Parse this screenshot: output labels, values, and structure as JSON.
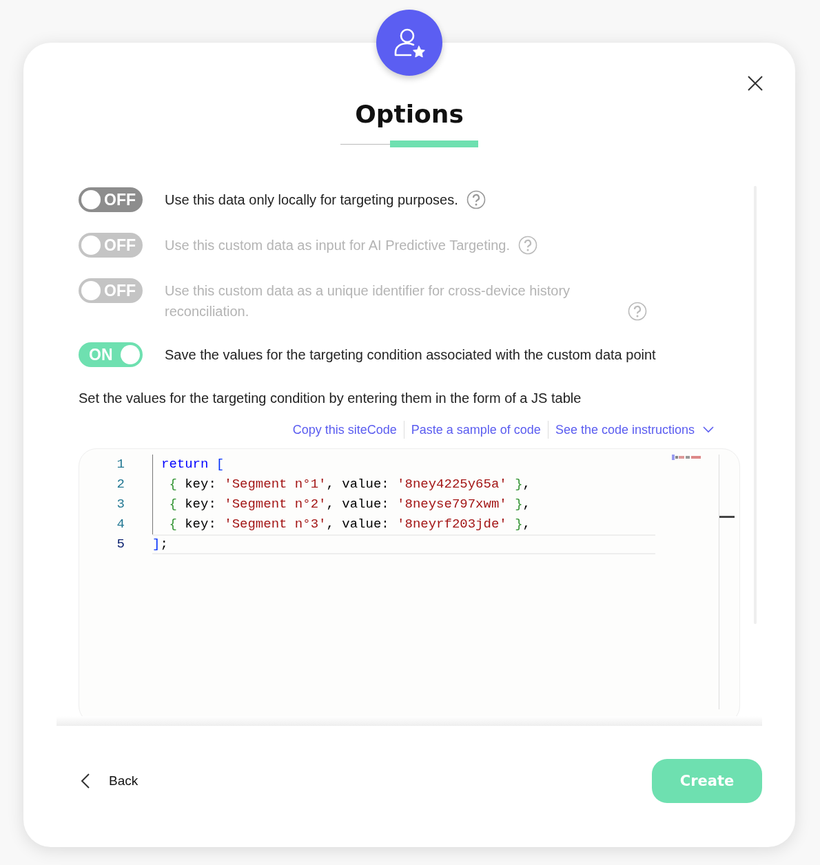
{
  "dialog": {
    "title": "Options",
    "step_indicator": {
      "level": 0.64
    },
    "options": [
      {
        "kind": "toggle",
        "on": false,
        "disabled": false,
        "state_label": "OFF",
        "label": "Use this data only locally for targeting purposes.",
        "help": true
      },
      {
        "kind": "toggle",
        "on": false,
        "disabled": true,
        "state_label": "OFF",
        "label": "Use this custom data as input for AI Predictive Targeting.",
        "help": true
      },
      {
        "kind": "toggle",
        "on": false,
        "disabled": true,
        "state_label": "OFF",
        "label": "Use this custom data as a unique identifier for cross-device history reconciliation.",
        "help": true
      },
      {
        "kind": "toggle",
        "on": true,
        "disabled": false,
        "state_label": "ON",
        "label": "Save the values for the targeting condition associated with the custom data point",
        "help": false
      }
    ],
    "description": "Set the values for the targeting condition by entering them in the form of a JS table",
    "links": [
      {
        "label": "Copy this siteCode"
      },
      {
        "label": "Paste a sample of code"
      },
      {
        "label": "See the code instructions",
        "dropdown": true
      }
    ],
    "editor": {
      "lines": [
        {
          "number": "1",
          "current": false,
          "tokens": [
            {
              "kind": "keyword",
              "text": "return"
            },
            {
              "kind": "bracket",
              "text": " ["
            }
          ]
        },
        {
          "number": "2",
          "current": false,
          "tokens": [
            {
              "kind": "brace",
              "text": " {"
            },
            {
              "kind": "plain",
              "text": " key: "
            },
            {
              "kind": "string",
              "text": "'Segment n°1'"
            },
            {
              "kind": "plain",
              "text": ", value: "
            },
            {
              "kind": "string",
              "text": "'8ney4225y65a'"
            },
            {
              "kind": "brace",
              "text": " }"
            },
            {
              "kind": "plain",
              "text": ","
            }
          ]
        },
        {
          "number": "3",
          "current": false,
          "tokens": [
            {
              "kind": "brace",
              "text": " {"
            },
            {
              "kind": "plain",
              "text": " key: "
            },
            {
              "kind": "string",
              "text": "'Segment n°2'"
            },
            {
              "kind": "plain",
              "text": ", value: "
            },
            {
              "kind": "string",
              "text": "'8neyse797xwm'"
            },
            {
              "kind": "brace",
              "text": " }"
            },
            {
              "kind": "plain",
              "text": ","
            }
          ]
        },
        {
          "number": "4",
          "current": false,
          "tokens": [
            {
              "kind": "brace",
              "text": " {"
            },
            {
              "kind": "plain",
              "text": " key: "
            },
            {
              "kind": "string",
              "text": "'Segment n°3'"
            },
            {
              "kind": "plain",
              "text": ", value: "
            },
            {
              "kind": "string",
              "text": "'8neyrf203jde'"
            },
            {
              "kind": "brace",
              "text": " }"
            },
            {
              "kind": "plain",
              "text": ","
            }
          ]
        },
        {
          "number": "5",
          "current": true,
          "tokens": [
            {
              "kind": "bracket",
              "text": "]"
            },
            {
              "kind": "plain",
              "text": ";"
            }
          ]
        }
      ]
    },
    "back_label": "Back",
    "create_label": "Create"
  }
}
